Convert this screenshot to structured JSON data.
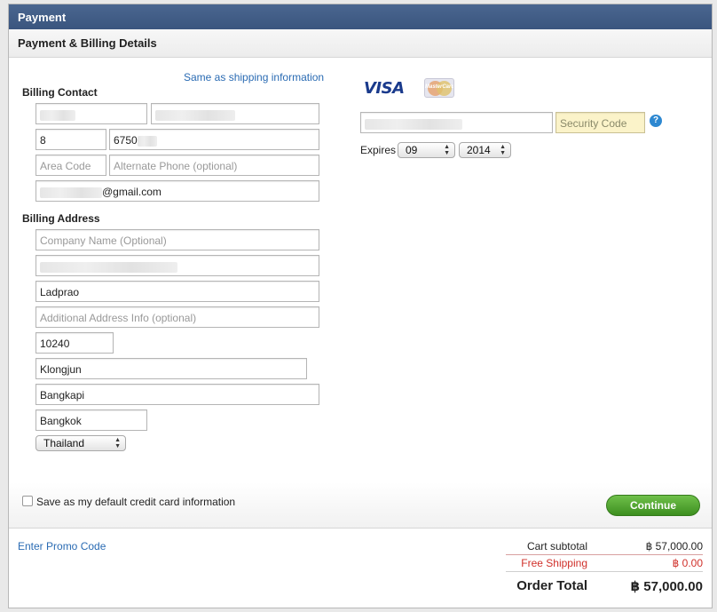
{
  "header": {
    "title": "Payment",
    "subtitle": "Payment & Billing Details"
  },
  "billing_contact": {
    "label": "Billing Contact",
    "same_as_shipping": "Same as shipping information",
    "first_name": "",
    "last_name": "",
    "phone_area": "8",
    "phone_number_prefix": "6750",
    "alt_area_placeholder": "Area Code",
    "alt_phone_placeholder": "Alternate Phone (optional)",
    "email_suffix": "@gmail.com"
  },
  "billing_address": {
    "label": "Billing Address",
    "company_placeholder": "Company Name (Optional)",
    "street": "",
    "street2": "Ladprao",
    "additional_placeholder": "Additional Address Info (optional)",
    "postal_code": "10240",
    "district": "Klongjun",
    "city": "Bangkapi",
    "province": "Bangkok",
    "country": "Thailand"
  },
  "card": {
    "visa_label": "VISA",
    "mastercard_label": "MasterCard",
    "security_placeholder": "Security Code",
    "help_icon": "?",
    "expires_label": "Expires",
    "exp_month": "09",
    "exp_year": "2014"
  },
  "options": {
    "save_default_label": "Save as my default credit card information",
    "continue_label": "Continue"
  },
  "summary": {
    "promo_link": "Enter Promo Code",
    "cart_subtotal_label": "Cart subtotal",
    "cart_subtotal_value": "฿ 57,000.00",
    "shipping_label": "Free Shipping",
    "shipping_value": "฿ 0.00",
    "order_total_label": "Order Total",
    "order_total_value": "฿ 57,000.00"
  },
  "colors": {
    "accent_blue": "#2a6bb3",
    "continue_green": "#4fa82c",
    "free_red": "#d0302a",
    "title_bar": "#3f5b84"
  }
}
